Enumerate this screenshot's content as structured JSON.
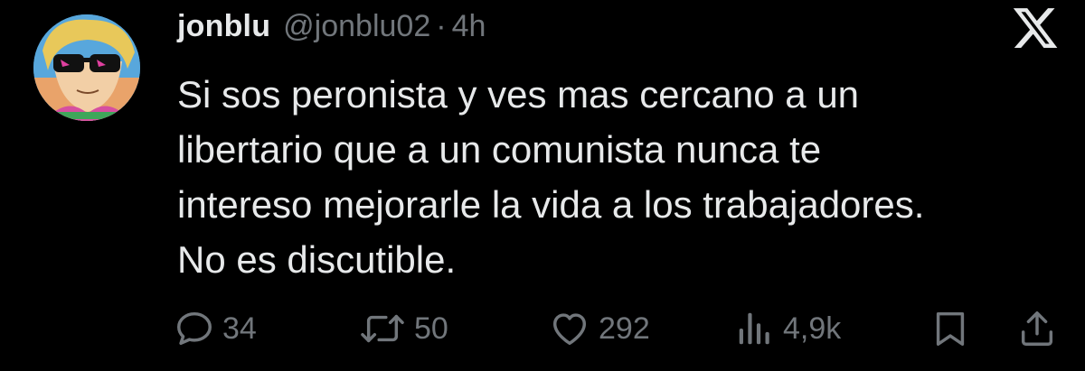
{
  "author": {
    "display_name": "jonblu",
    "handle": "@jonblu02",
    "separator": "·",
    "time": "4h"
  },
  "platform_logo_icon": "x-logo-icon",
  "tweet": {
    "lines": [
      "Si sos peronista y ves mas cercano a un",
      "libertario que a un comunista nunca te",
      "intereso mejorarle la vida a los trabajadores.",
      "No es discutible."
    ]
  },
  "actions": {
    "replies": "34",
    "reposts": "50",
    "likes": "292",
    "views": "4,9k"
  },
  "colors": {
    "background": "#000000",
    "text_primary": "#e7e9ea",
    "text_secondary": "#71767b"
  }
}
